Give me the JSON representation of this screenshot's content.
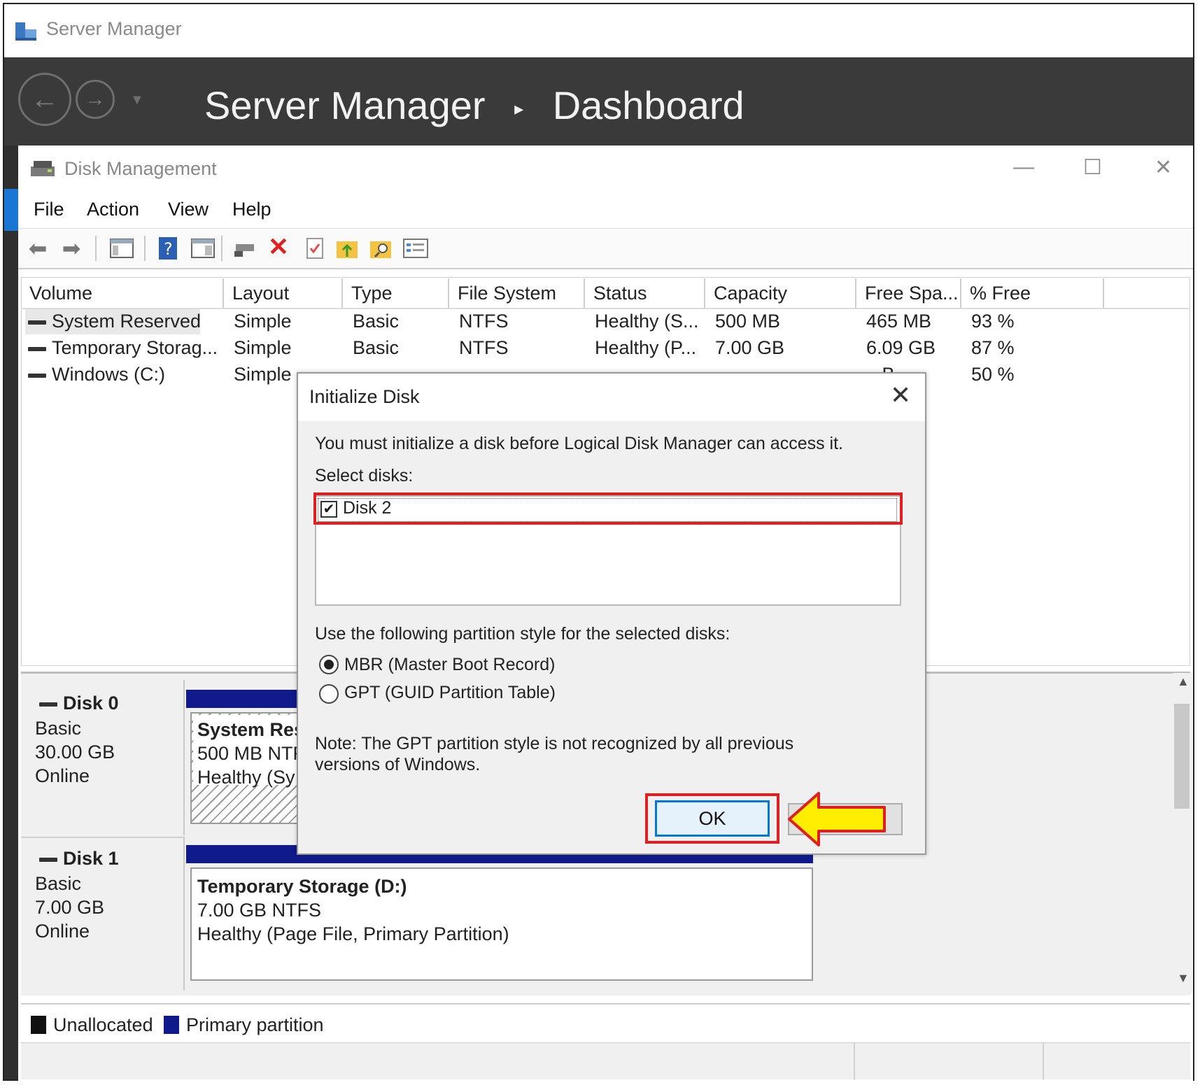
{
  "server_manager": {
    "window_title": "Server Manager",
    "heading": "Server Manager",
    "separator": "▸",
    "page": "Dashboard"
  },
  "disk_management": {
    "window_title": "Disk Management",
    "controls": {
      "minimize": "—",
      "maximize": "☐",
      "close": "✕"
    },
    "menu": [
      "File",
      "Action",
      "View",
      "Help"
    ],
    "toolbar_icons": [
      "back-icon",
      "forward-icon",
      "console-tree-icon",
      "help-icon",
      "show-hide-icon",
      "connect-icon",
      "delete-icon",
      "properties-icon",
      "folder-up-icon",
      "folder-search-icon",
      "list-icon"
    ],
    "columns": [
      "Volume",
      "Layout",
      "Type",
      "File System",
      "Status",
      "Capacity",
      "Free Spa...",
      "% Free"
    ],
    "volumes": [
      {
        "volume": "System Reserved",
        "layout": "Simple",
        "type": "Basic",
        "fs": "NTFS",
        "status": "Healthy (S...",
        "capacity": "500 MB",
        "free": "465 MB",
        "pct": "93 %"
      },
      {
        "volume": "Temporary Storag...",
        "layout": "Simple",
        "type": "Basic",
        "fs": "NTFS",
        "status": "Healthy (P...",
        "capacity": "7.00 GB",
        "free": "6.09 GB",
        "pct": "87 %"
      },
      {
        "volume": "Windows (C:)",
        "layout": "Simple",
        "type": "",
        "fs": "",
        "status": "",
        "capacity": "",
        "free": "...B",
        "pct": "50 %"
      }
    ],
    "disks": [
      {
        "name": "Disk 0",
        "type": "Basic",
        "size": "30.00 GB",
        "state": "Online",
        "partition": {
          "name": "System Res",
          "detail": "500 MB NTF",
          "status": "Healthy (Sy"
        }
      },
      {
        "name": "Disk 1",
        "type": "Basic",
        "size": "7.00 GB",
        "state": "Online",
        "partition": {
          "name": "Temporary Storage  (D:)",
          "detail": "7.00 GB NTFS",
          "status": "Healthy (Page File, Primary Partition)"
        }
      }
    ],
    "legend": [
      {
        "label": "Unallocated",
        "color": "#111111"
      },
      {
        "label": "Primary partition",
        "color": "#101a8a"
      }
    ]
  },
  "dialog": {
    "title": "Initialize Disk",
    "close": "✕",
    "intro": "You must initialize a disk before Logical Disk Manager can access it.",
    "select_label": "Select disks:",
    "disk_item": "Disk 2",
    "disk_checked": true,
    "partition_label": "Use the following partition style for the selected disks:",
    "options": [
      "MBR (Master Boot Record)",
      "GPT (GUID Partition Table)"
    ],
    "selected_option": "MBR (Master Boot Record)",
    "note": "Note: The GPT partition style is not recognized by all previous versions of Windows.",
    "ok_label": "OK",
    "cancel_label": ""
  },
  "annotations": {
    "highlight_color": "#e02020",
    "arrow_color": "#ffee00"
  }
}
